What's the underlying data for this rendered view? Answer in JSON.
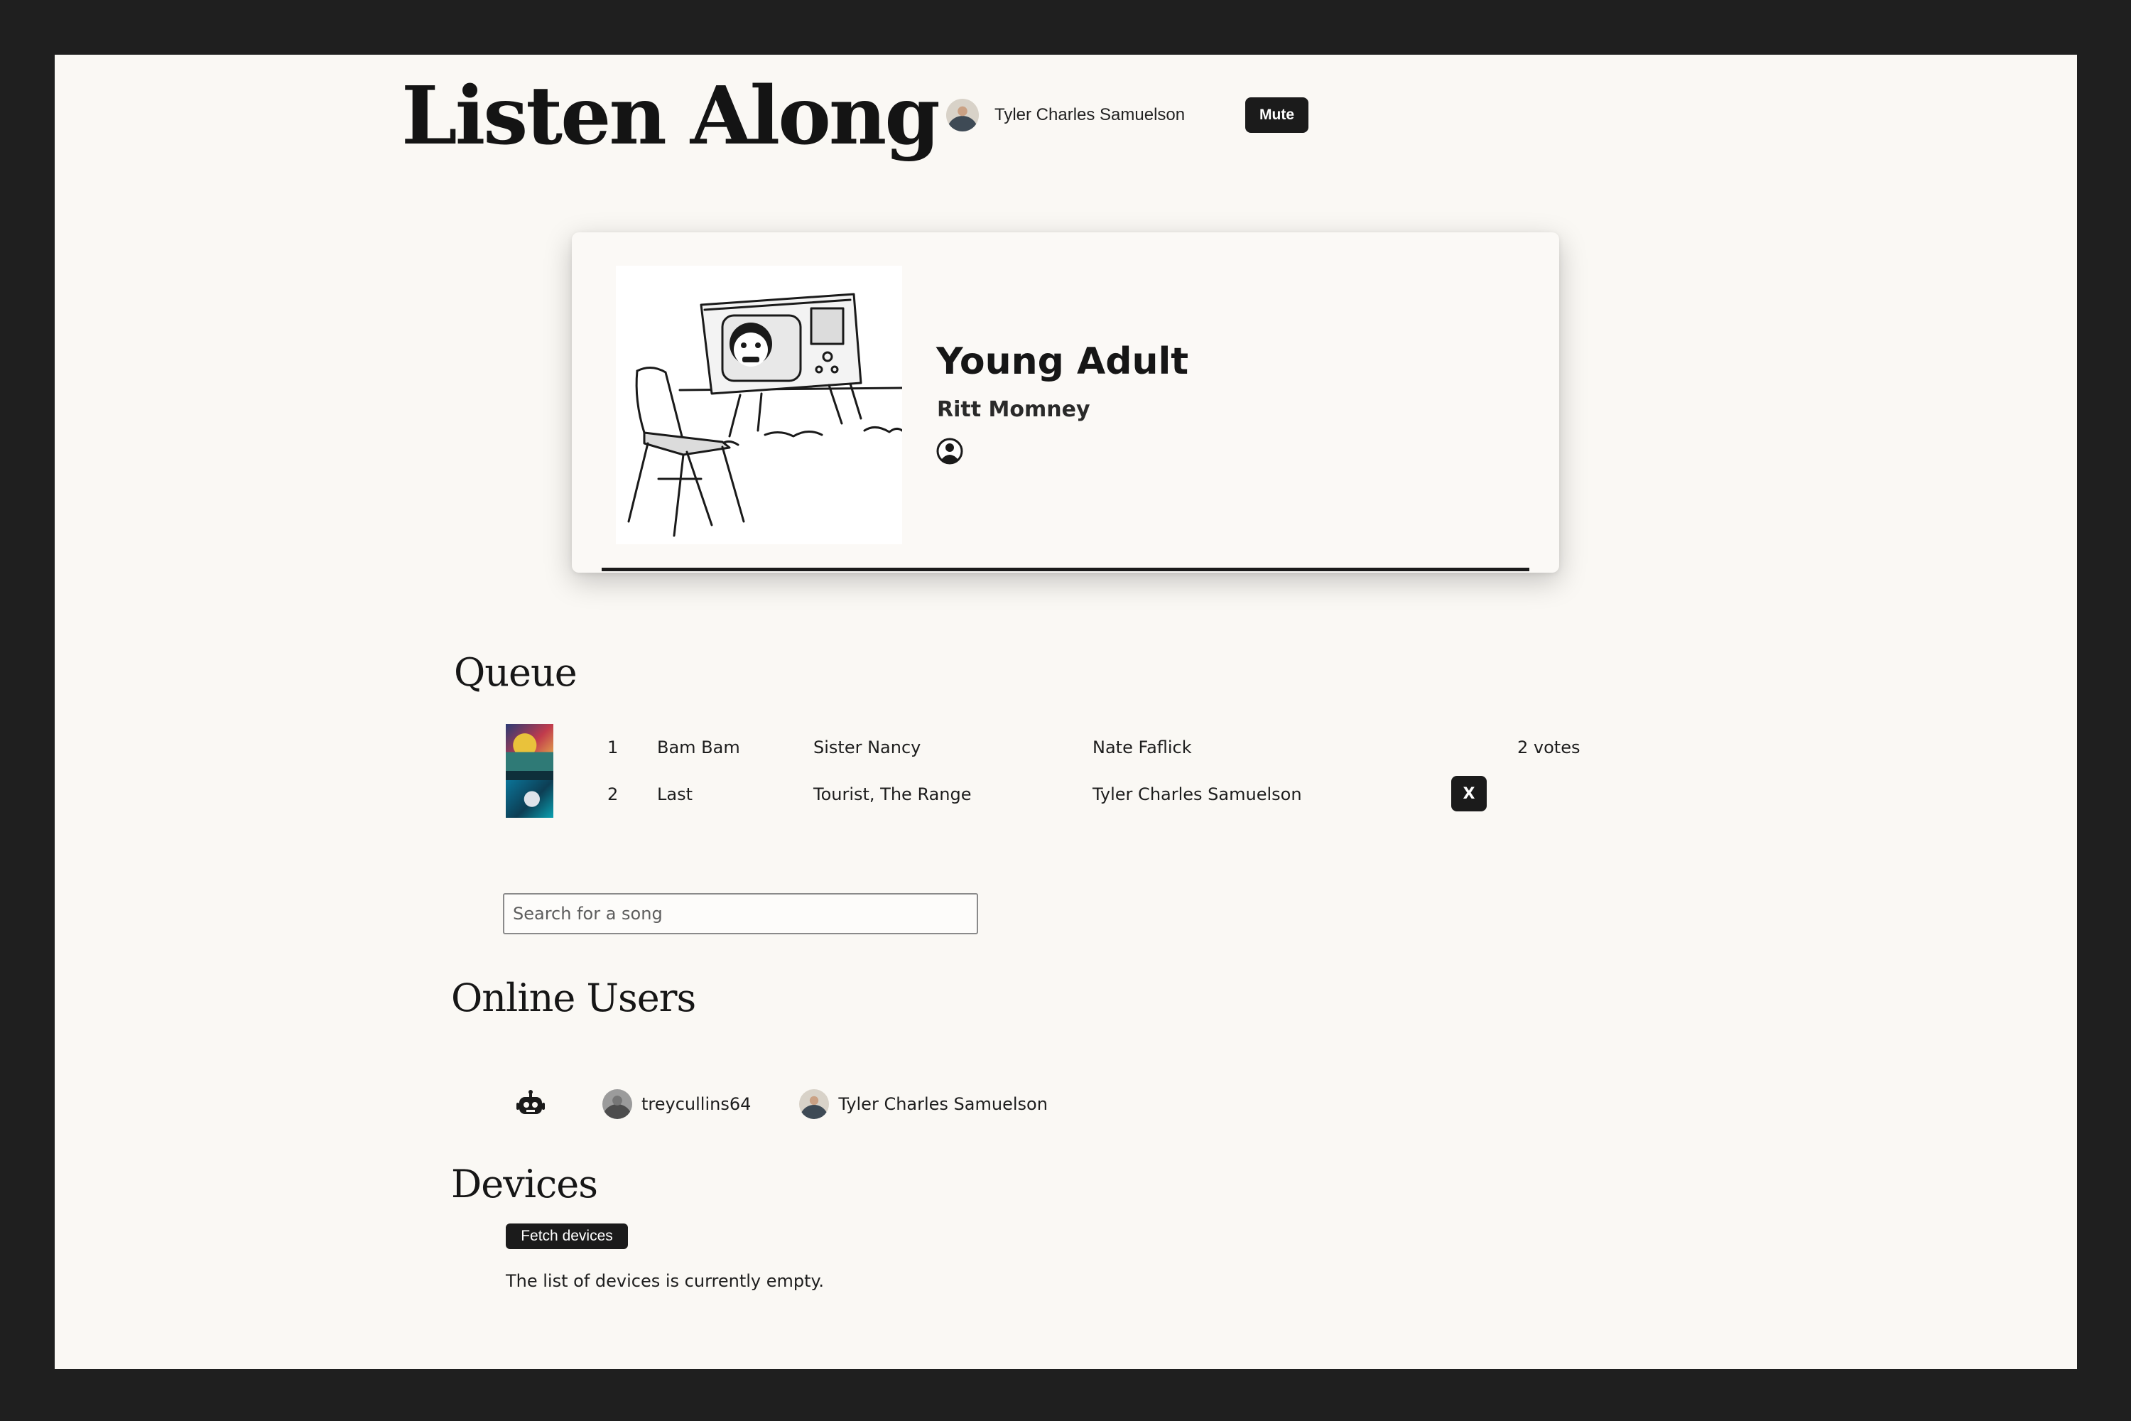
{
  "app": {
    "logo_text": "Listen Along"
  },
  "header": {
    "user_name": "Tyler Charles Samuelson",
    "mute_label": "Mute"
  },
  "now_playing": {
    "title": "Young Adult",
    "artist": "Ritt Momney",
    "added_by_icon": "user-circle-icon",
    "progress": 1.0
  },
  "queue": {
    "heading": "Queue",
    "rows": [
      {
        "position": "1",
        "song": "Bam Bam",
        "artist": "Sister Nancy",
        "added_by": "Nate Faflick",
        "votes": "2 votes",
        "remove_label": ""
      },
      {
        "position": "2",
        "song": "Last",
        "artist": "Tourist, The Range",
        "added_by": "Tyler Charles Samuelson",
        "votes": "",
        "remove_label": "X"
      }
    ],
    "search_placeholder": "Search for a song"
  },
  "online_users": {
    "heading": "Online Users",
    "bot_icon": "robot-icon",
    "users": [
      "treycullins64",
      "Tyler Charles Samuelson"
    ]
  },
  "devices": {
    "heading": "Devices",
    "fetch_label": "Fetch devices",
    "empty_message": "The list of devices is currently empty."
  },
  "colors": {
    "page_background": "#faf8f4",
    "outer_background": "#1f1f1f",
    "button_background": "#1b1b1b",
    "button_text": "#ffffff"
  }
}
